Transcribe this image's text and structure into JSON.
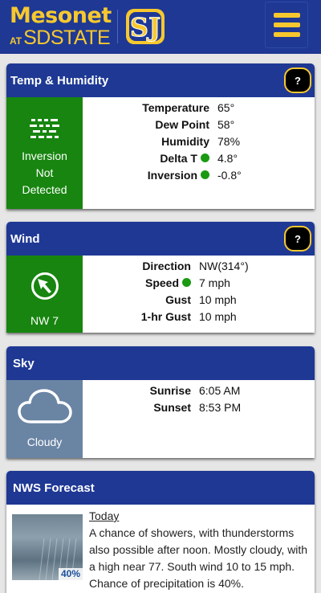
{
  "header": {
    "brand_top": "Mesonet",
    "brand_at": "AT",
    "brand_school": "SDSTATE",
    "logo_icon": "sdsu-jackrabbits-logo",
    "menu_icon": "hamburger-menu-icon"
  },
  "colors": {
    "header": "#1e3894",
    "accent": "#f7c82e",
    "status_green": "#17850f",
    "sky_gray": "#6a84a4",
    "indicator_dot": "#1a9a12"
  },
  "temp_humidity": {
    "title": "Temp & Humidity",
    "help": "?",
    "side_icon": "inversion-icon",
    "side_label_1": "Inversion",
    "side_label_2": "Not",
    "side_label_3": "Detected",
    "rows": [
      {
        "label": "Temperature",
        "value": "65°"
      },
      {
        "label": "Dew Point",
        "value": "58°"
      },
      {
        "label": "Humidity",
        "value": "78%"
      },
      {
        "label": "Delta T",
        "value": "4.8°"
      },
      {
        "label": "Inversion",
        "value": "-0.8°"
      }
    ]
  },
  "wind": {
    "title": "Wind",
    "help": "?",
    "side_icon": "wind-direction-arrow-icon",
    "side_label": "NW 7",
    "rows": [
      {
        "label": "Direction",
        "value": "NW(314°)"
      },
      {
        "label": "Speed",
        "value": "7 mph"
      },
      {
        "label": "Gust",
        "value": "10 mph"
      },
      {
        "label": "1-hr Gust",
        "value": "10 mph"
      }
    ]
  },
  "sky": {
    "title": "Sky",
    "side_icon": "cloud-icon",
    "side_label": "Cloudy",
    "rows": [
      {
        "label": "Sunrise",
        "value": "6:05 AM"
      },
      {
        "label": "Sunset",
        "value": "8:53 PM"
      }
    ]
  },
  "forecast": {
    "title": "NWS Forecast",
    "image_icon": "rain-showers-image",
    "pop": "40%",
    "day": "Today",
    "text": "A chance of showers, with thunderstorms also possible after noon. Mostly cloudy, with a high near 77. South wind 10 to 15 mph. Chance of precipitation is 40%."
  }
}
